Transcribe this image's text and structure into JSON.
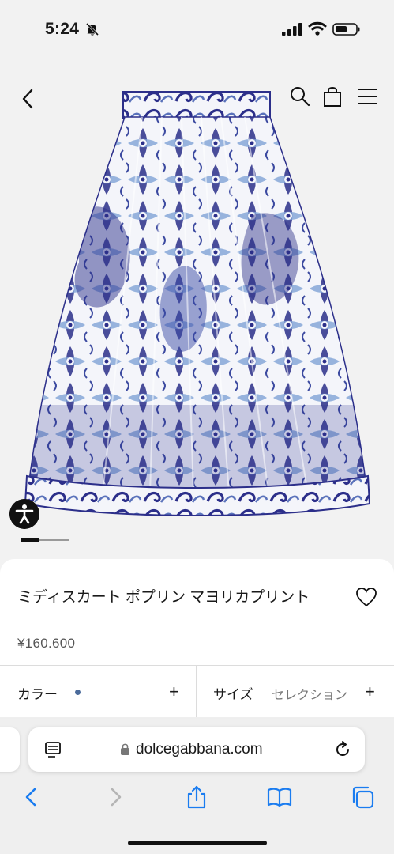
{
  "status_bar": {
    "time": "5:24",
    "icons": [
      "bell-slash-icon",
      "signal-icon",
      "wifi-icon",
      "battery-icon"
    ]
  },
  "header": {
    "icons": [
      "chevron-left-icon",
      "search-icon",
      "shopping-bag-icon",
      "hamburger-menu-icon"
    ]
  },
  "product": {
    "title": "ミディスカート ポプリン マヨリカプリント",
    "price": "¥160.600",
    "image_description_icon": "skirt-image",
    "colors": {
      "accent": "#2c2f8a",
      "light": "#7fa3d6",
      "swatch": "#4b6b9b"
    }
  },
  "carousel": {
    "active_index": 1,
    "total": 3
  },
  "options": {
    "color_label": "カラー",
    "size_label": "サイズ",
    "size_value": "セレクション",
    "plus": "+"
  },
  "browser": {
    "url": "dolcegabbana.com",
    "toolbar_icons": [
      "back-arrow-icon",
      "forward-arrow-icon",
      "share-icon",
      "bookmarks-icon",
      "tabs-icon"
    ]
  }
}
